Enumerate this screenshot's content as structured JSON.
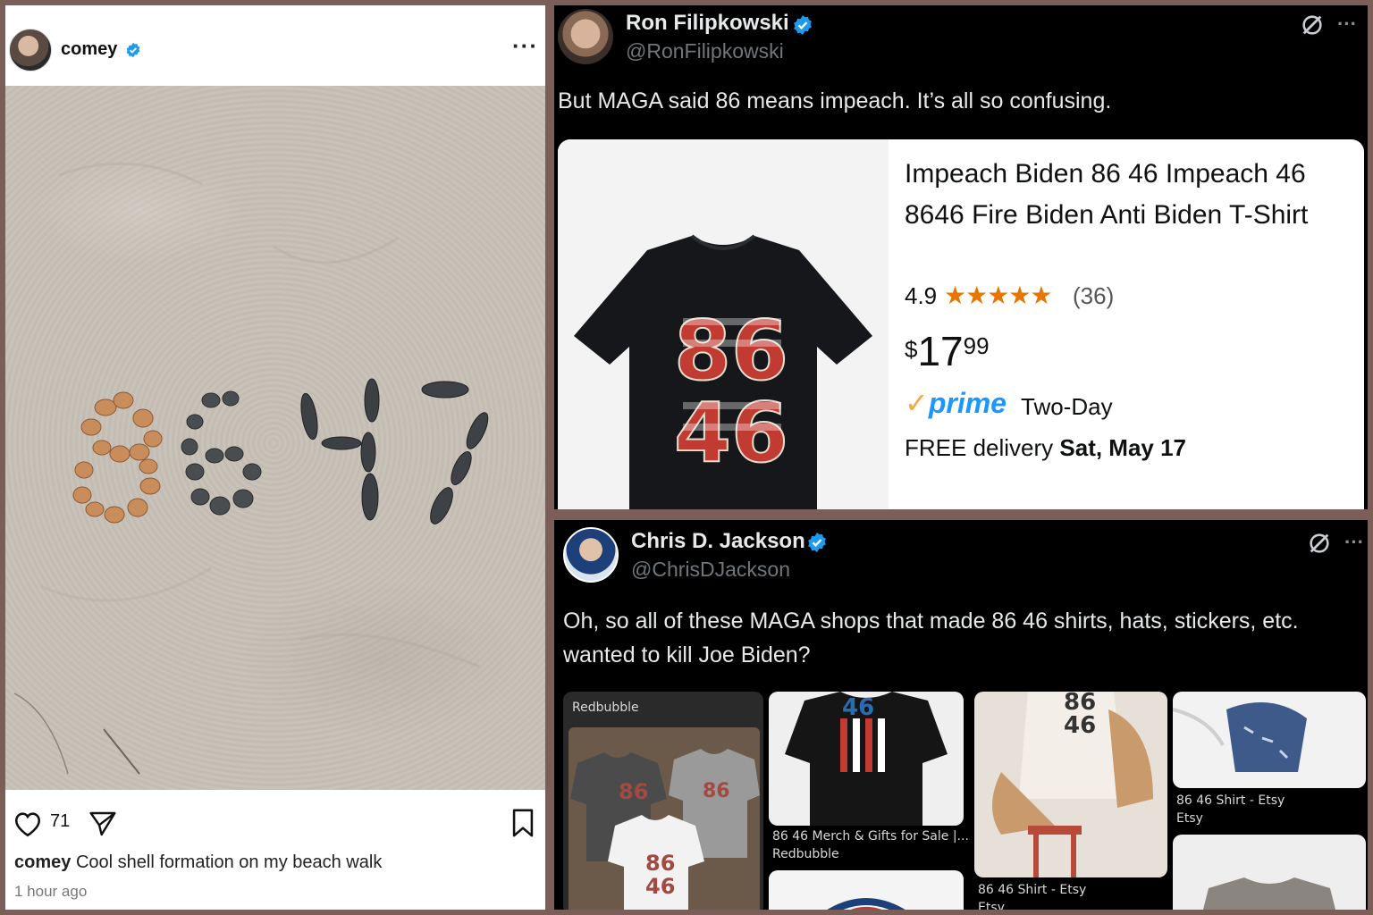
{
  "instagram": {
    "username": "comey",
    "photo_shell_text": "8647",
    "likes": "71",
    "caption_user": "comey",
    "caption_text": "Cool shell formation on my beach walk",
    "timestamp": "1 hour ago",
    "icons": [
      "verified-badge-icon",
      "more-icon",
      "heart-icon",
      "share-icon",
      "bookmark-icon"
    ]
  },
  "tweet1": {
    "name": "Ron Filipkowski",
    "handle": "@RonFilipkowski",
    "text": "But MAGA said 86 means impeach. It’s all so confusing.",
    "more": "···",
    "product": {
      "title": "Impeach Biden 86 46 Impeach 46 8646 Fire Biden Anti Biden T-Shirt",
      "rating": "4.9",
      "stars": "★★★★★",
      "review_count": "(36)",
      "price_currency": "$",
      "price_whole": "17",
      "price_fraction": "99",
      "prime_check": "✓",
      "prime_label": "prime",
      "shipping": "Two-Day",
      "delivery_prefix": "FREE delivery",
      "delivery_date": "Sat, May 17",
      "shirt_top": "86",
      "shirt_bottom": "46"
    }
  },
  "tweet2": {
    "name": "Chris D. Jackson",
    "handle": "@ChrisDJackson",
    "text": "Oh, so all of these MAGA shops that made 86 46 shirts, hats, stickers, etc. wanted to kill Joe Biden?",
    "more": "···",
    "results": [
      {
        "caption": "Redbubble",
        "shirt_text_top": "86",
        "shirt_text_bottom": "46"
      },
      {
        "caption": "86 46 Merch & Gifts for Sale |...",
        "source": "Redbubble",
        "shirt_text_top": "46"
      },
      {
        "caption": "86 46 Shirt - Etsy",
        "source": "Etsy",
        "shirt_text_top": "86",
        "shirt_text_bottom": "46"
      },
      {
        "caption": "86 46 Shirt - Etsy",
        "source": "Etsy"
      }
    ]
  },
  "colors": {
    "frame": "#7b5e58",
    "twitter_bg": "#000000",
    "verified_blue": "#1d9bf0",
    "amazon_star": "#e77600",
    "prime_blue": "#1a98ff"
  }
}
